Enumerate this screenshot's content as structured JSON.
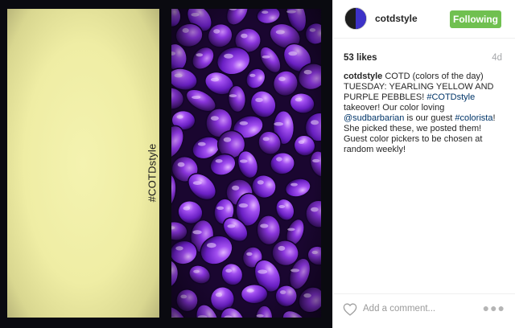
{
  "post": {
    "image_hashtag": "#COTDstyle",
    "header": {
      "username": "cotdstyle",
      "follow_label": "Following"
    },
    "stats": {
      "likes": "53 likes",
      "age": "4d"
    },
    "caption": {
      "username": "cotdstyle",
      "text_1": "COTD (colors of the day) TUESDAY: YEARLING YELLOW AND PURPLE PEBBLES! ",
      "hashtag_1": "#COTDstyle",
      "text_2": " takeover! Our color loving ",
      "mention": "@sudbarbarian",
      "text_3": " is our guest ",
      "hashtag_2": "#colorista",
      "text_4": "! She picked these, we posted them! Guest color pickers to be chosen at random weekly!"
    },
    "comment": {
      "placeholder": "Add a comment..."
    },
    "icons": {
      "like": "heart-icon",
      "more": "more-options-icon",
      "avatar": "avatar"
    },
    "colors": {
      "follow_button": "#70c050",
      "link": "#003569",
      "swatch_yellow": "#efeda4",
      "pebble_purple": "#7a2fd0"
    }
  }
}
